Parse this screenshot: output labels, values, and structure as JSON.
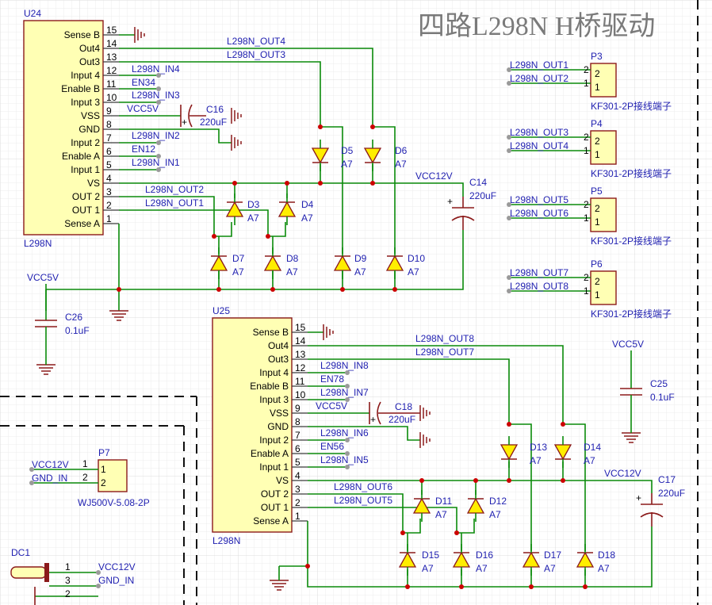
{
  "title": "四路L298N H桥驱动",
  "colors": {
    "wire": "#0a8a0a",
    "component": "#8b1a1a",
    "ic_fill": "#ffffb4",
    "diode_fill": "#ffee00",
    "net_text": "#1f1fb0",
    "junction": "#cc0000",
    "grid": "#e8e8e8"
  },
  "ic_pin_names": [
    "Sense B",
    "Out4",
    "Out3",
    "Input 4",
    "Enable B",
    "Input 3",
    "VSS",
    "GND",
    "Input 2",
    "Enable A",
    "Input 1",
    "VS",
    "OUT 2",
    "OUT 1",
    "Sense A"
  ],
  "ic_pin_numbers": [
    "15",
    "14",
    "13",
    "12",
    "11",
    "10",
    "9",
    "8",
    "7",
    "6",
    "5",
    "4",
    "3",
    "2",
    "1"
  ],
  "u24": {
    "designator": "U24",
    "part": "L298N",
    "nets": [
      "L298N_IN4",
      "EN34",
      "L298N_IN3",
      "VCC5V",
      "L298N_IN2",
      "EN12",
      "L298N_IN1",
      "L298N_OUT2",
      "L298N_OUT1"
    ],
    "top_nets": [
      "L298N_OUT4",
      "L298N_OUT3"
    ],
    "cap": {
      "designator": "C16",
      "value": "220uF"
    },
    "vs_net": "VCC12V",
    "bulk_cap": {
      "designator": "C14",
      "value": "220uF"
    },
    "diodes": [
      {
        "designator": "D3",
        "value": "A7"
      },
      {
        "designator": "D4",
        "value": "A7"
      },
      {
        "designator": "D5",
        "value": "A7"
      },
      {
        "designator": "D6",
        "value": "A7"
      },
      {
        "designator": "D7",
        "value": "A7"
      },
      {
        "designator": "D8",
        "value": "A7"
      },
      {
        "designator": "D9",
        "value": "A7"
      },
      {
        "designator": "D10",
        "value": "A7"
      }
    ],
    "bypass": {
      "net": "VCC5V",
      "designator": "C26",
      "value": "0.1uF"
    }
  },
  "u25": {
    "designator": "U25",
    "part": "L298N",
    "nets": [
      "L298N_IN8",
      "EN78",
      "L298N_IN7",
      "VCC5V",
      "L298N_IN6",
      "EN56",
      "L298N_IN5",
      "L298N_OUT6",
      "L298N_OUT5"
    ],
    "top_nets": [
      "L298N_OUT8",
      "L298N_OUT7"
    ],
    "cap": {
      "designator": "C18",
      "value": "220uF"
    },
    "vs_net": "VCC12V",
    "bulk_cap": {
      "designator": "C17",
      "value": "220uF"
    },
    "diodes": [
      {
        "designator": "D11",
        "value": "A7"
      },
      {
        "designator": "D12",
        "value": "A7"
      },
      {
        "designator": "D13",
        "value": "A7"
      },
      {
        "designator": "D14",
        "value": "A7"
      },
      {
        "designator": "D15",
        "value": "A7"
      },
      {
        "designator": "D16",
        "value": "A7"
      },
      {
        "designator": "D17",
        "value": "A7"
      },
      {
        "designator": "D18",
        "value": "A7"
      }
    ],
    "bypass": {
      "net": "VCC5V",
      "designator": "C25",
      "value": "0.1uF"
    }
  },
  "terminals": [
    {
      "designator": "P3",
      "part": "KF301-2P接线端子",
      "net_top": "L298N_OUT1",
      "net_bottom": "L298N_OUT2"
    },
    {
      "designator": "P4",
      "part": "KF301-2P接线端子",
      "net_top": "L298N_OUT3",
      "net_bottom": "L298N_OUT4"
    },
    {
      "designator": "P5",
      "part": "KF301-2P接线端子",
      "net_top": "L298N_OUT5",
      "net_bottom": "L298N_OUT6"
    },
    {
      "designator": "P6",
      "part": "KF301-2P接线端子",
      "net_top": "L298N_OUT7",
      "net_bottom": "L298N_OUT8"
    }
  ],
  "power_connector": {
    "designator": "P7",
    "part": "WJ500V-5.08-2P",
    "net1": "VCC12V",
    "net2": "GND_IN"
  },
  "dc_jack": {
    "designator": "DC1",
    "net1": "VCC12V",
    "net3": "GND_IN"
  },
  "pin_labels": {
    "one": "1",
    "two": "2",
    "three": "3"
  }
}
